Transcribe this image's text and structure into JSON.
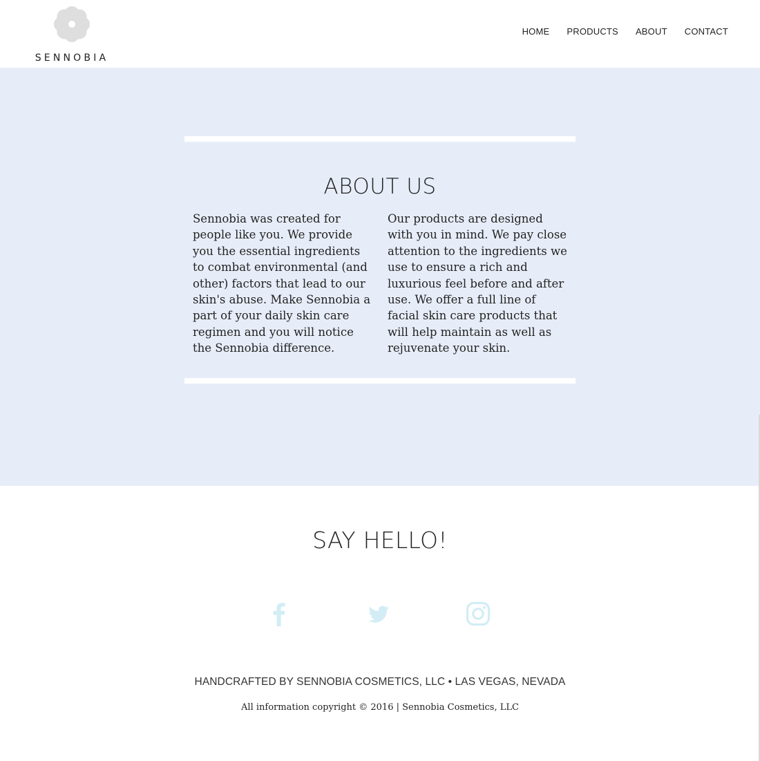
{
  "brand": {
    "logo_text": "SENNOBIA",
    "logo_icon": "flower-icon",
    "logo_color": "#dedede"
  },
  "nav": {
    "items": [
      {
        "label": "HOME"
      },
      {
        "label": "PRODUCTS"
      },
      {
        "label": "ABOUT"
      },
      {
        "label": "CONTACT"
      }
    ]
  },
  "about": {
    "background": "#e7edf8",
    "title": "ABOUT US",
    "left_text": "Sennobia was created for people like you. We provide you the essential ingredients to combat environmental (and other) factors that lead to our skin's abuse. Make Sennobia a part of your daily skin care regimen and you will notice the Sennobia difference.",
    "right_text": "Our products are designed with you in mind. We pay close attention to the ingredients we use to ensure a rich and luxurious feel before and after use. We offer a full line of facial skin care products that will help maintain as well as rejuvenate your skin."
  },
  "hello": {
    "title": "SAY HELLO!",
    "social": [
      {
        "icon": "facebook-icon"
      },
      {
        "icon": "twitter-icon"
      },
      {
        "icon": "instagram-icon"
      }
    ],
    "icon_color": "#d2edf5"
  },
  "footer": {
    "line": "HANDCRAFTED BY SENNOBIA COSMETICS, LLC • LAS VEGAS, NEVADA",
    "copyright": "All information copyright © 2016 | Sennobia Cosmetics, LLC"
  }
}
